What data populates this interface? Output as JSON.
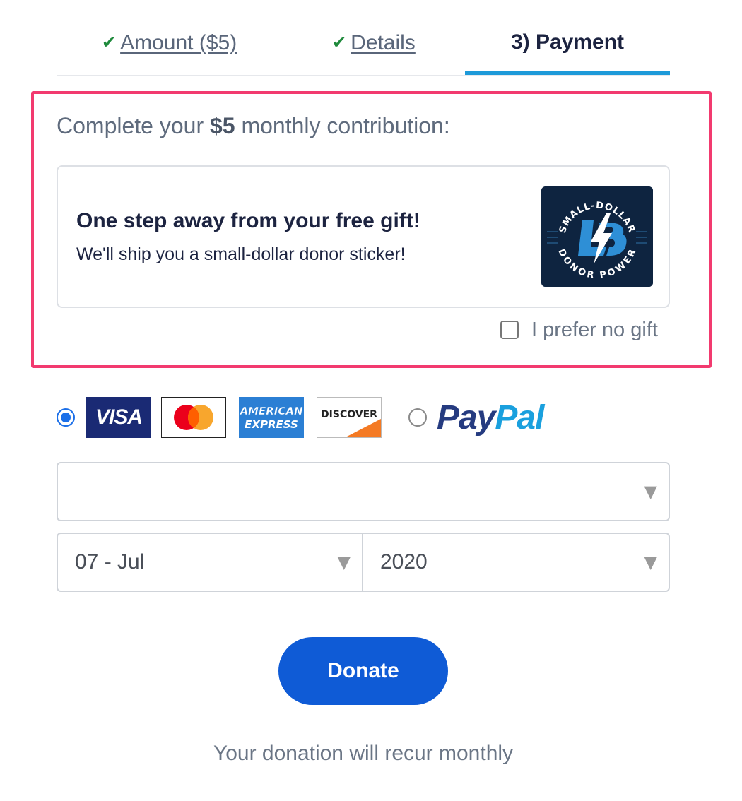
{
  "tabs": {
    "amount_label": "Amount ($5)",
    "details_label": "Details",
    "payment_label": "3) Payment",
    "check_glyph": "✔"
  },
  "contribution": {
    "prefix": "Complete your",
    "amount": "$5",
    "suffix": "monthly contribution:"
  },
  "gift": {
    "title": "One step away from your free gift!",
    "subtitle": "We'll ship you a small-dollar donor sticker!",
    "sticker_top_text": "SMALL-DOLLAR",
    "sticker_bottom_text": "DONOR POWER",
    "no_gift_label": "I prefer no gift",
    "no_gift_checked": false
  },
  "payment_methods": {
    "card_selected": true,
    "visa": "VISA",
    "amex_line1": "AMERICAN",
    "amex_line2": "EXPRESS",
    "discover": "DISCOVER",
    "paypal_pay": "Pay",
    "paypal_pal": "Pal"
  },
  "card_form": {
    "card_select_value": "",
    "month_value": "07 - Jul",
    "year_value": "2020",
    "arrow_glyph": "▼"
  },
  "donate_label": "Donate",
  "recur_note": "Your donation will recur monthly",
  "colors": {
    "accent_blue": "#0f5bd6",
    "highlight_pink": "#f23a6f",
    "tab_underline": "#1d9ad9",
    "check_green": "#1f8a3c"
  }
}
